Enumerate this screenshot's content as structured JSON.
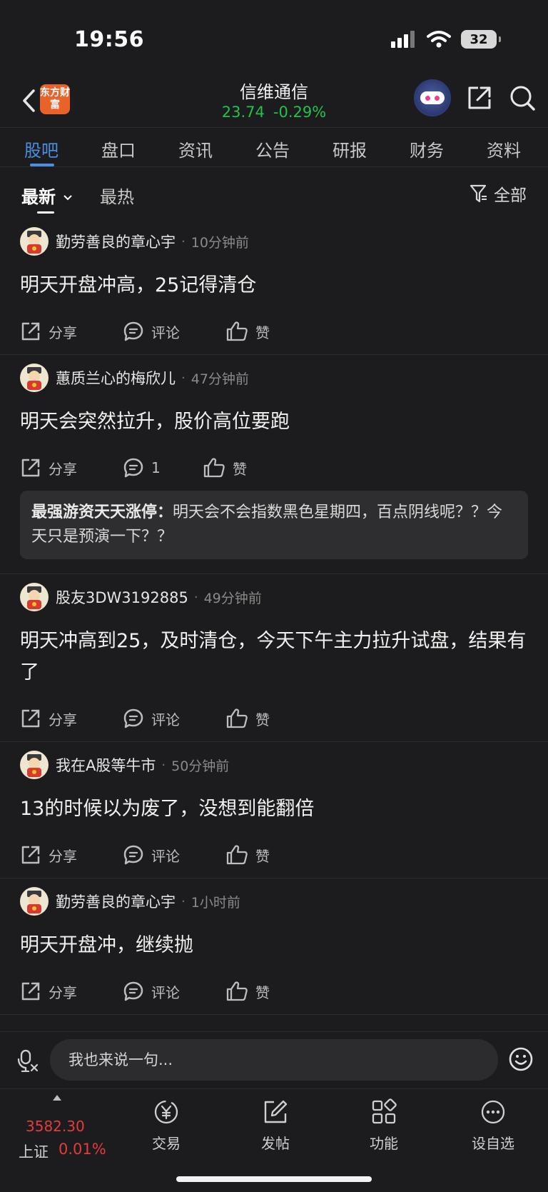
{
  "status_bar": {
    "time": "19:56",
    "battery": "32"
  },
  "header": {
    "logo_text": "东方财富",
    "stock_name": "信维通信",
    "price": "23.74",
    "change": "-0.29%"
  },
  "tabs": [
    "股吧",
    "盘口",
    "资讯",
    "公告",
    "研报",
    "财务",
    "资料"
  ],
  "sort": {
    "newest": "最新",
    "hottest": "最热",
    "filter": "全部"
  },
  "posts": [
    {
      "author": "勤劳善良的章心宇",
      "time": "10分钟前",
      "text": "明天开盘冲高，25记得清仓",
      "share": "分享",
      "comment": "评论",
      "like": "赞"
    },
    {
      "author": "蕙质兰心的梅欣儿",
      "time": "47分钟前",
      "text": "明天会突然拉升，股价高位要跑",
      "share": "分享",
      "comment": "1",
      "like": "赞",
      "reply": {
        "name": "最强游资天天涨停：",
        "text": "明天会不会指数黑色星期四，百点阴线呢？？今天只是预演一下？？"
      }
    },
    {
      "author": "股友3DW3192885",
      "time": "49分钟前",
      "text": "明天冲高到25，及时清仓，今天下午主力拉升试盘，结果有了",
      "share": "分享",
      "comment": "评论",
      "like": "赞"
    },
    {
      "author": "我在A股等牛市",
      "time": "50分钟前",
      "text": "13的时候以为废了，没想到能翻倍",
      "share": "分享",
      "comment": "评论",
      "like": "赞"
    },
    {
      "author": "勤劳善良的章心宇",
      "time": "1小时前",
      "text": "明天开盘冲，继续抛",
      "share": "分享",
      "comment": "评论",
      "like": "赞"
    }
  ],
  "comment_bar": {
    "placeholder": "我也来说一句..."
  },
  "tabbar": {
    "index_value": "3582.30",
    "index_name": "上证",
    "index_pct": "0.01%",
    "items": [
      "交易",
      "发帖",
      "功能",
      "设自选"
    ]
  },
  "colors": {
    "accent": "#4a90e2",
    "up": "#e43b3b",
    "down": "#22c14a",
    "background": "#1c1c1e"
  }
}
